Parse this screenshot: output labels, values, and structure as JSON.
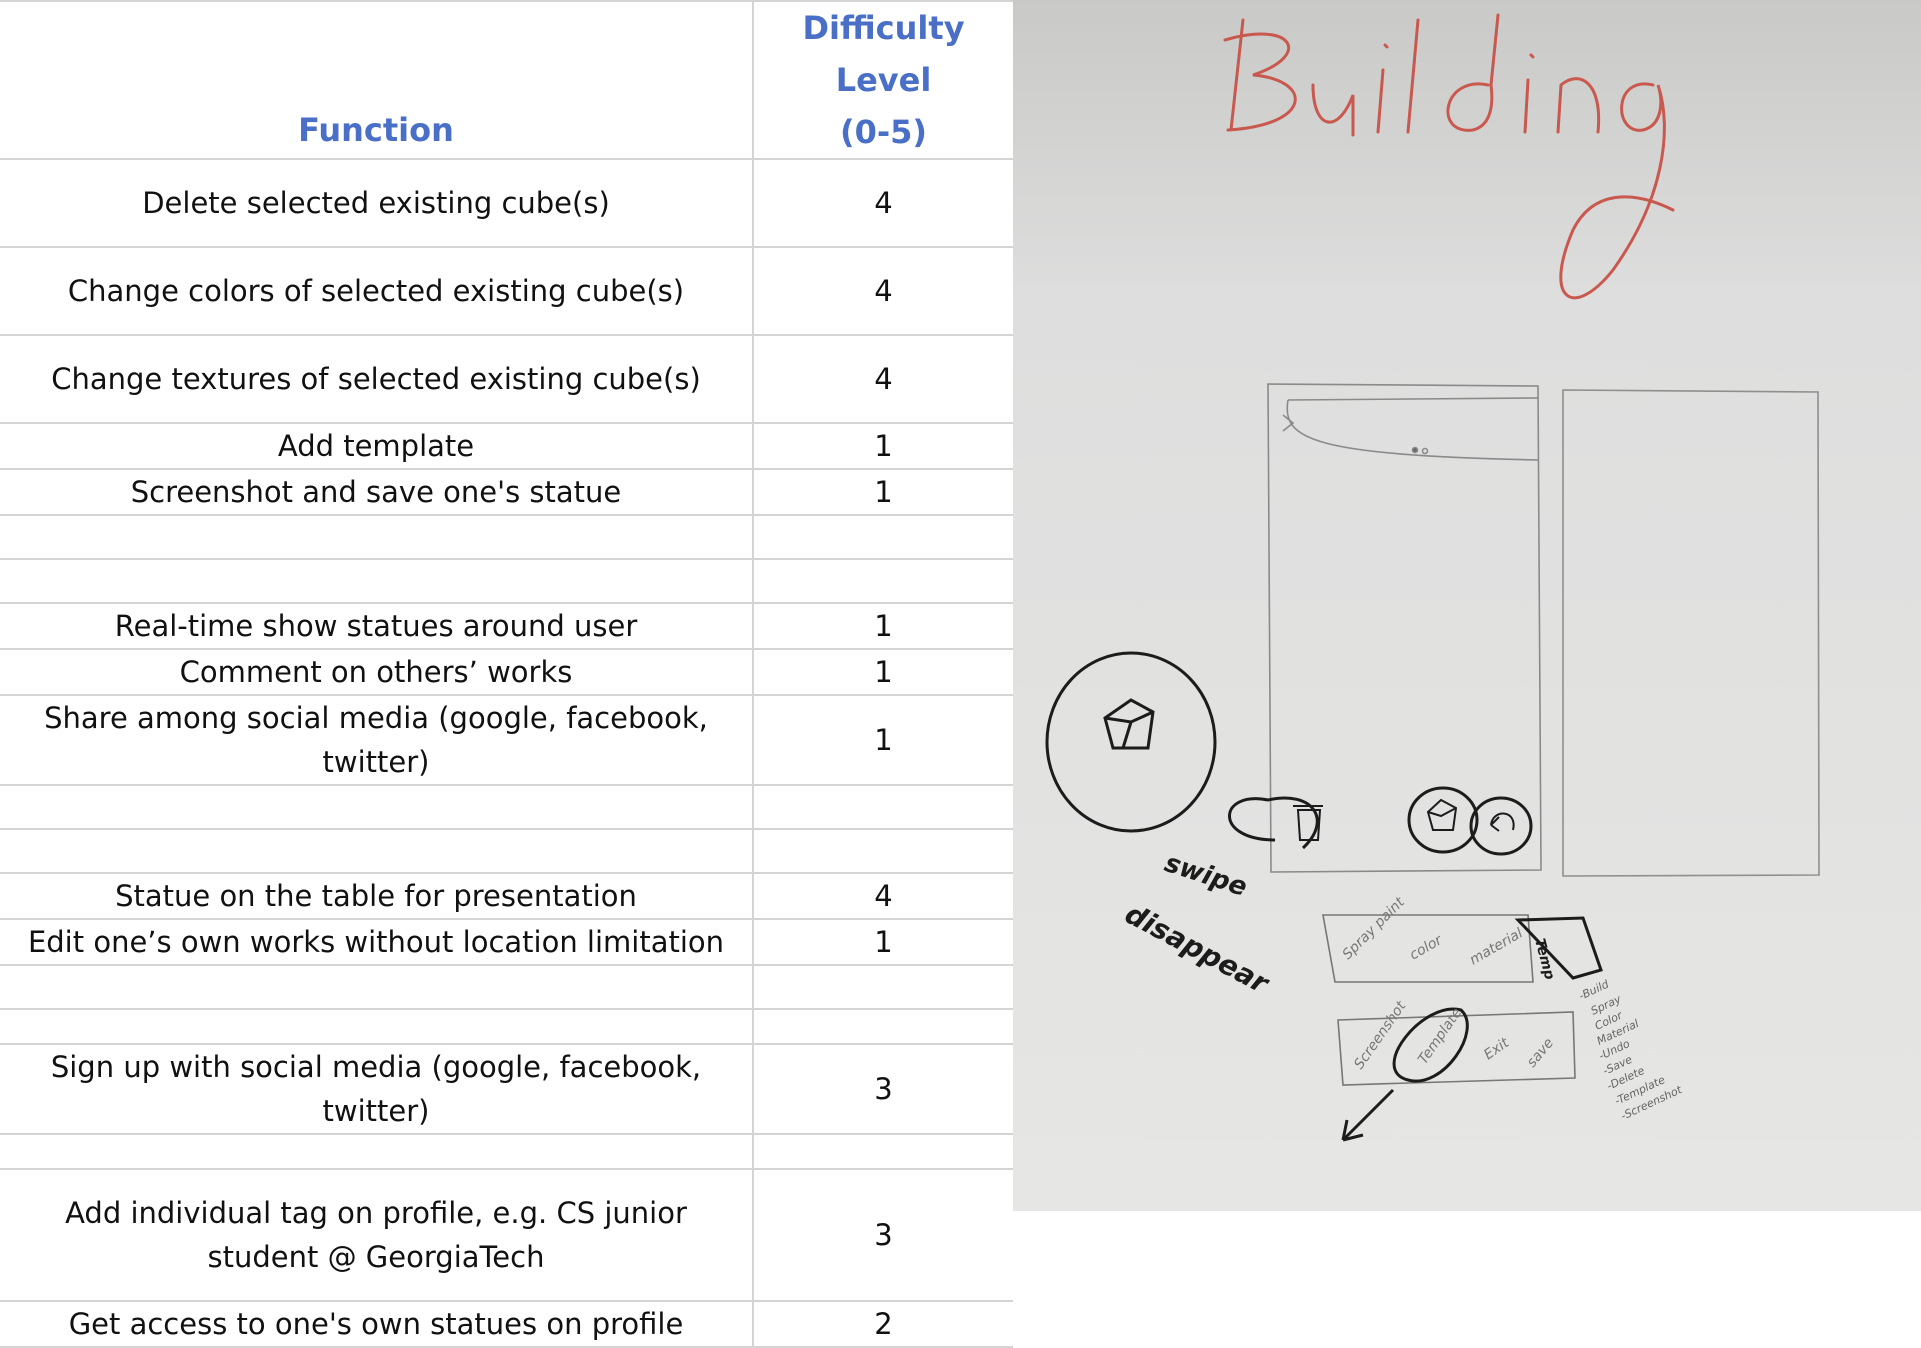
{
  "table": {
    "headers": {
      "function": "Function",
      "difficulty_line1": "Difficulty Level",
      "difficulty_line2": "(0-5)"
    },
    "rows": [
      {
        "function": "Delete selected existing cube(s)",
        "level": "4",
        "h": 88
      },
      {
        "function": "Change colors of selected existing cube(s)",
        "level": "4",
        "h": 88
      },
      {
        "function": "Change textures of selected existing cube(s)",
        "level": "4",
        "h": 88
      },
      {
        "function": "Add template",
        "level": "1",
        "h": 44
      },
      {
        "function": "Screenshot and save one's statue",
        "level": "1",
        "h": 44
      },
      {
        "function": "",
        "level": "",
        "h": 44
      },
      {
        "function": "",
        "level": "",
        "h": 44
      },
      {
        "function": "Real-time show statues around user",
        "level": "1",
        "h": 44
      },
      {
        "function": "Comment on others’ works",
        "level": "1",
        "h": 44
      },
      {
        "function": "Share among social media (google, facebook, twitter)",
        "level": "1",
        "h": 44
      },
      {
        "function": "",
        "level": "",
        "h": 44
      },
      {
        "function": "",
        "level": "",
        "h": 44
      },
      {
        "function": "Statue on the table for presentation",
        "level": "4",
        "h": 44
      },
      {
        "function": "Edit one’s own works without location limitation",
        "level": "1",
        "h": 44
      },
      {
        "function": "",
        "level": "",
        "h": 44
      },
      {
        "function": "",
        "level": "",
        "h": 35
      },
      {
        "function": "Sign up with social media (google, facebook, twitter)",
        "level": "3",
        "h": 44
      },
      {
        "function": "",
        "level": "",
        "h": 35
      },
      {
        "function": "Add individual tag on profile, e.g. CS junior student @ GeorgiaTech",
        "level": "3",
        "h": 132
      },
      {
        "function": "Get access to one's own statues on profile",
        "level": "2",
        "h": 44
      }
    ]
  },
  "sketch": {
    "title": "Building",
    "annotations": {
      "swipe": "swipe",
      "disappear": "disappear",
      "spray_paint": "Spray paint",
      "color": "color",
      "material": "material",
      "temp": "Temp",
      "screenshot": "Screenshot",
      "template": "Template",
      "exit": "Exit",
      "save": "save"
    },
    "notes": [
      "-Build",
      "Spray",
      "Color",
      "Material",
      "-Undo",
      "-Save",
      "-Delete",
      "-Template",
      "-Screenshot"
    ]
  }
}
